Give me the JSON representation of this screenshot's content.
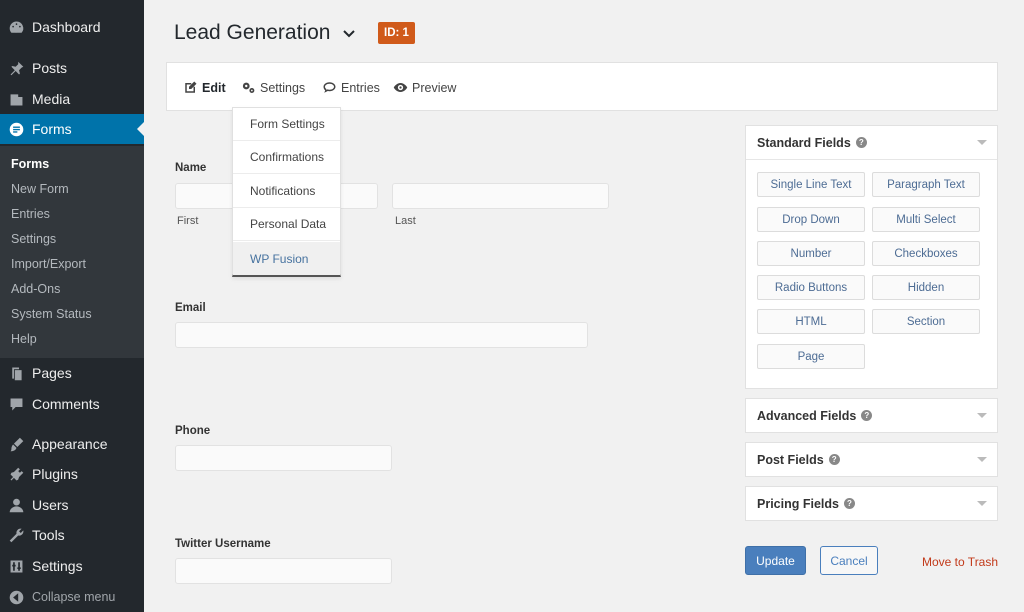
{
  "sidebar": {
    "items": [
      {
        "label": "Dashboard",
        "icon": "dashboard-icon"
      },
      {
        "label": "Posts",
        "icon": "pin-icon"
      },
      {
        "label": "Media",
        "icon": "media-icon"
      },
      {
        "label": "Forms",
        "icon": "forms-icon"
      },
      {
        "label": "Pages",
        "icon": "pages-icon"
      },
      {
        "label": "Comments",
        "icon": "comment-icon"
      },
      {
        "label": "Appearance",
        "icon": "brush-icon"
      },
      {
        "label": "Plugins",
        "icon": "plugin-icon"
      },
      {
        "label": "Users",
        "icon": "user-icon"
      },
      {
        "label": "Tools",
        "icon": "wrench-icon"
      },
      {
        "label": "Settings",
        "icon": "sliders-icon"
      },
      {
        "label": "Collapse menu",
        "icon": "collapse-icon"
      }
    ],
    "submenu": [
      "Forms",
      "New Form",
      "Entries",
      "Settings",
      "Import/Export",
      "Add-Ons",
      "System Status",
      "Help"
    ]
  },
  "header": {
    "title": "Lead Generation",
    "id_badge": "ID: 1"
  },
  "toolbar": {
    "edit": "Edit",
    "settings": "Settings",
    "entries": "Entries",
    "preview": "Preview"
  },
  "settings_menu": [
    "Form Settings",
    "Confirmations",
    "Notifications",
    "Personal Data",
    "WP Fusion"
  ],
  "form": {
    "name_label": "Name",
    "first_label": "First",
    "last_label": "Last",
    "email_label": "Email",
    "phone_label": "Phone",
    "twitter_label": "Twitter Username"
  },
  "panels": {
    "standard": {
      "title": "Standard Fields",
      "buttons": [
        "Single Line Text",
        "Paragraph Text",
        "Drop Down",
        "Multi Select",
        "Number",
        "Checkboxes",
        "Radio Buttons",
        "Hidden",
        "HTML",
        "Section",
        "Page"
      ]
    },
    "advanced": "Advanced Fields",
    "post": "Post Fields",
    "pricing": "Pricing Fields"
  },
  "actions": {
    "update": "Update",
    "cancel": "Cancel",
    "trash": "Move to Trash"
  },
  "colors": {
    "sidebar_bg": "#23282d",
    "accent": "#0073aa",
    "badge": "#d05a1a",
    "update_button": "#4a7fbd",
    "trash_link": "#c23a1a"
  }
}
